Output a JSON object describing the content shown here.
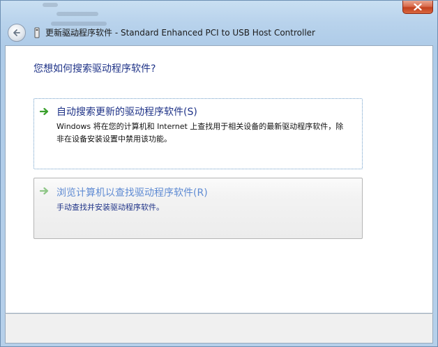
{
  "window": {
    "title": "更新驱动程序软件 - Standard Enhanced PCI to USB Host Controller"
  },
  "page": {
    "question": "您想如何搜索驱动程序软件?"
  },
  "options": [
    {
      "title": "自动搜索更新的驱动程序软件(S)",
      "description": "Windows 将在您的计算机和 Internet 上查找用于相关设备的最新驱动程序软件，除非在设备安装设置中禁用该功能。"
    },
    {
      "title": "浏览计算机以查找驱动程序软件(R)",
      "description": "手动查找并安装驱动程序软件。"
    }
  ],
  "icons": {
    "back": "back-arrow-icon",
    "close": "close-icon",
    "device": "usb-device-icon",
    "option_arrow": "green-arrow-icon"
  },
  "colors": {
    "heading": "#1e3287",
    "arrow": "#3aa02c",
    "close": "#c2401e"
  }
}
